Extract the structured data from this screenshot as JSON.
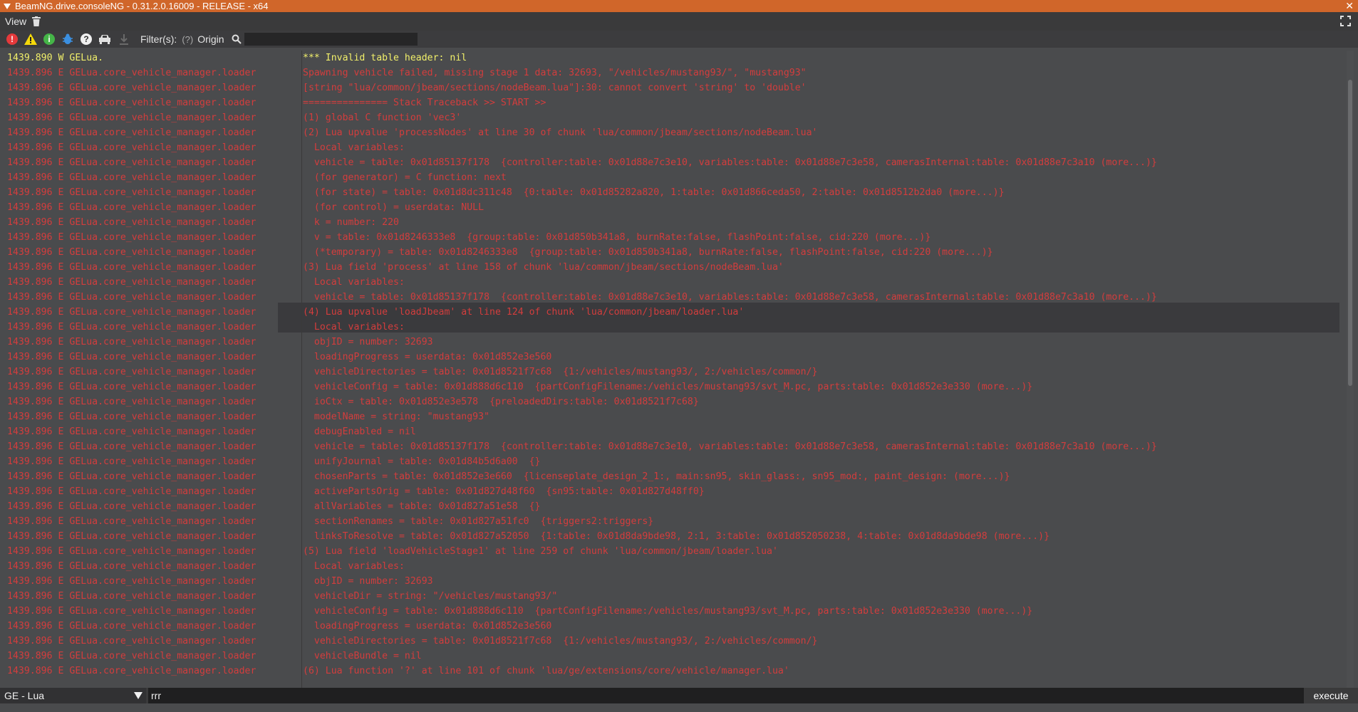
{
  "window": {
    "title": "BeamNG.drive.consoleNG - 0.31.2.0.16009 - RELEASE - x64",
    "close_glyph": "✕"
  },
  "menu": {
    "view_label": "View"
  },
  "toolbar": {
    "filter_label": "Filter(s):",
    "filter_help": "(?)",
    "origin_label": "Origin",
    "search_value": ""
  },
  "log": [
    {
      "level": "W",
      "time": "1439.890",
      "src": "GELua.",
      "msg": "*** Invalid table header: nil"
    },
    {
      "level": "E",
      "time": "1439.896",
      "src": "GELua.core_vehicle_manager.loader",
      "msg": "Spawning vehicle failed, missing stage 1 data: 32693, \"/vehicles/mustang93/\", \"mustang93\""
    },
    {
      "level": "E",
      "time": "1439.896",
      "src": "GELua.core_vehicle_manager.loader",
      "msg": "[string \"lua/common/jbeam/sections/nodeBeam.lua\"]:30: cannot convert 'string' to 'double'"
    },
    {
      "level": "E",
      "time": "1439.896",
      "src": "GELua.core_vehicle_manager.loader",
      "msg": "=============== Stack Traceback >> START >>"
    },
    {
      "level": "E",
      "time": "1439.896",
      "src": "GELua.core_vehicle_manager.loader",
      "msg": "(1) global C function 'vec3'"
    },
    {
      "level": "E",
      "time": "1439.896",
      "src": "GELua.core_vehicle_manager.loader",
      "msg": "(2) Lua upvalue 'processNodes' at line 30 of chunk 'lua/common/jbeam/sections/nodeBeam.lua'"
    },
    {
      "level": "E",
      "time": "1439.896",
      "src": "GELua.core_vehicle_manager.loader",
      "msg": "  Local variables:"
    },
    {
      "level": "E",
      "time": "1439.896",
      "src": "GELua.core_vehicle_manager.loader",
      "msg": "  vehicle = table: 0x01d85137f178  {controller:table: 0x01d88e7c3e10, variables:table: 0x01d88e7c3e58, camerasInternal:table: 0x01d88e7c3a10 (more...)}"
    },
    {
      "level": "E",
      "time": "1439.896",
      "src": "GELua.core_vehicle_manager.loader",
      "msg": "  (for generator) = C function: next"
    },
    {
      "level": "E",
      "time": "1439.896",
      "src": "GELua.core_vehicle_manager.loader",
      "msg": "  (for state) = table: 0x01d8dc311c48  {0:table: 0x01d85282a820, 1:table: 0x01d866ceda50, 2:table: 0x01d8512b2da0 (more...)}"
    },
    {
      "level": "E",
      "time": "1439.896",
      "src": "GELua.core_vehicle_manager.loader",
      "msg": "  (for control) = userdata: NULL"
    },
    {
      "level": "E",
      "time": "1439.896",
      "src": "GELua.core_vehicle_manager.loader",
      "msg": "  k = number: 220"
    },
    {
      "level": "E",
      "time": "1439.896",
      "src": "GELua.core_vehicle_manager.loader",
      "msg": "  v = table: 0x01d8246333e8  {group:table: 0x01d850b341a8, burnRate:false, flashPoint:false, cid:220 (more...)}"
    },
    {
      "level": "E",
      "time": "1439.896",
      "src": "GELua.core_vehicle_manager.loader",
      "msg": "  (*temporary) = table: 0x01d8246333e8  {group:table: 0x01d850b341a8, burnRate:false, flashPoint:false, cid:220 (more...)}"
    },
    {
      "level": "E",
      "time": "1439.896",
      "src": "GELua.core_vehicle_manager.loader",
      "msg": "(3) Lua field 'process' at line 158 of chunk 'lua/common/jbeam/sections/nodeBeam.lua'"
    },
    {
      "level": "E",
      "time": "1439.896",
      "src": "GELua.core_vehicle_manager.loader",
      "msg": "  Local variables:"
    },
    {
      "level": "E",
      "time": "1439.896",
      "src": "GELua.core_vehicle_manager.loader",
      "msg": "  vehicle = table: 0x01d85137f178  {controller:table: 0x01d88e7c3e10, variables:table: 0x01d88e7c3e58, camerasInternal:table: 0x01d88e7c3a10 (more...)}"
    },
    {
      "level": "E",
      "time": "1439.896",
      "src": "GELua.core_vehicle_manager.loader",
      "msg": "(4) Lua upvalue 'loadJbeam' at line 124 of chunk 'lua/common/jbeam/loader.lua'"
    },
    {
      "level": "E",
      "time": "1439.896",
      "src": "GELua.core_vehicle_manager.loader",
      "msg": "  Local variables:"
    },
    {
      "level": "E",
      "time": "1439.896",
      "src": "GELua.core_vehicle_manager.loader",
      "msg": "  objID = number: 32693"
    },
    {
      "level": "E",
      "time": "1439.896",
      "src": "GELua.core_vehicle_manager.loader",
      "msg": "  loadingProgress = userdata: 0x01d852e3e560"
    },
    {
      "level": "E",
      "time": "1439.896",
      "src": "GELua.core_vehicle_manager.loader",
      "msg": "  vehicleDirectories = table: 0x01d8521f7c68  {1:/vehicles/mustang93/, 2:/vehicles/common/}"
    },
    {
      "level": "E",
      "time": "1439.896",
      "src": "GELua.core_vehicle_manager.loader",
      "msg": "  vehicleConfig = table: 0x01d888d6c110  {partConfigFilename:/vehicles/mustang93/svt_M.pc, parts:table: 0x01d852e3e330 (more...)}"
    },
    {
      "level": "E",
      "time": "1439.896",
      "src": "GELua.core_vehicle_manager.loader",
      "msg": "  ioCtx = table: 0x01d852e3e578  {preloadedDirs:table: 0x01d8521f7c68}"
    },
    {
      "level": "E",
      "time": "1439.896",
      "src": "GELua.core_vehicle_manager.loader",
      "msg": "  modelName = string: \"mustang93\""
    },
    {
      "level": "E",
      "time": "1439.896",
      "src": "GELua.core_vehicle_manager.loader",
      "msg": "  debugEnabled = nil"
    },
    {
      "level": "E",
      "time": "1439.896",
      "src": "GELua.core_vehicle_manager.loader",
      "msg": "  vehicle = table: 0x01d85137f178  {controller:table: 0x01d88e7c3e10, variables:table: 0x01d88e7c3e58, camerasInternal:table: 0x01d88e7c3a10 (more...)}"
    },
    {
      "level": "E",
      "time": "1439.896",
      "src": "GELua.core_vehicle_manager.loader",
      "msg": "  unifyJournal = table: 0x01d84b5d6a00  {}"
    },
    {
      "level": "E",
      "time": "1439.896",
      "src": "GELua.core_vehicle_manager.loader",
      "msg": "  chosenParts = table: 0x01d852e3e660  {licenseplate_design_2_1:, main:sn95, skin_glass:, sn95_mod:, paint_design: (more...)}"
    },
    {
      "level": "E",
      "time": "1439.896",
      "src": "GELua.core_vehicle_manager.loader",
      "msg": "  activePartsOrig = table: 0x01d827d48f60  {sn95:table: 0x01d827d48ff0}"
    },
    {
      "level": "E",
      "time": "1439.896",
      "src": "GELua.core_vehicle_manager.loader",
      "msg": "  allVariables = table: 0x01d827a51e58  {}"
    },
    {
      "level": "E",
      "time": "1439.896",
      "src": "GELua.core_vehicle_manager.loader",
      "msg": "  sectionRenames = table: 0x01d827a51fc0  {triggers2:triggers}"
    },
    {
      "level": "E",
      "time": "1439.896",
      "src": "GELua.core_vehicle_manager.loader",
      "msg": "  linksToResolve = table: 0x01d827a52050  {1:table: 0x01d8da9bde98, 2:1, 3:table: 0x01d852050238, 4:table: 0x01d8da9bde98 (more...)}"
    },
    {
      "level": "E",
      "time": "1439.896",
      "src": "GELua.core_vehicle_manager.loader",
      "msg": "(5) Lua field 'loadVehicleStage1' at line 259 of chunk 'lua/common/jbeam/loader.lua'"
    },
    {
      "level": "E",
      "time": "1439.896",
      "src": "GELua.core_vehicle_manager.loader",
      "msg": "  Local variables:"
    },
    {
      "level": "E",
      "time": "1439.896",
      "src": "GELua.core_vehicle_manager.loader",
      "msg": "  objID = number: 32693"
    },
    {
      "level": "E",
      "time": "1439.896",
      "src": "GELua.core_vehicle_manager.loader",
      "msg": "  vehicleDir = string: \"/vehicles/mustang93/\""
    },
    {
      "level": "E",
      "time": "1439.896",
      "src": "GELua.core_vehicle_manager.loader",
      "msg": "  vehicleConfig = table: 0x01d888d6c110  {partConfigFilename:/vehicles/mustang93/svt_M.pc, parts:table: 0x01d852e3e330 (more...)}"
    },
    {
      "level": "E",
      "time": "1439.896",
      "src": "GELua.core_vehicle_manager.loader",
      "msg": "  loadingProgress = userdata: 0x01d852e3e560"
    },
    {
      "level": "E",
      "time": "1439.896",
      "src": "GELua.core_vehicle_manager.loader",
      "msg": "  vehicleDirectories = table: 0x01d8521f7c68  {1:/vehicles/mustang93/, 2:/vehicles/common/}"
    },
    {
      "level": "E",
      "time": "1439.896",
      "src": "GELua.core_vehicle_manager.loader",
      "msg": "  vehicleBundle = nil"
    },
    {
      "level": "E",
      "time": "1439.896",
      "src": "GELua.core_vehicle_manager.loader",
      "msg": "(6) Lua function '?' at line 101 of chunk 'lua/ge/extensions/core/vehicle/manager.lua'"
    }
  ],
  "bottom": {
    "context_label": "GE - Lua",
    "command_value": "rrr",
    "execute_label": "execute"
  },
  "colors": {
    "error": "#d33d3d",
    "warning": "#f1ef6a",
    "title_bar": "#d0662a"
  }
}
